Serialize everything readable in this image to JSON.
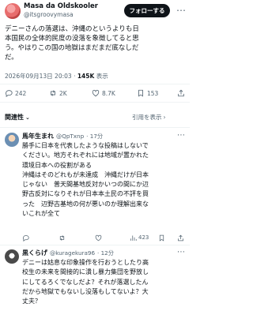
{
  "header": {
    "name": "Masa da Oldskooler",
    "handle": "@itsgroovymasa",
    "follow_label": "フォローする",
    "more": "⋯"
  },
  "post": {
    "lines": [
      "デニーさんの落選は、沖縄のというよりも日",
      "本国民の全体的民度の没落を象徴してると思",
      "う。やはりこの国の地獄はまだまだ底なしだ",
      "だ。"
    ],
    "datetime": "2026年09月13日 20:03",
    "views_count": "145K",
    "views_label": "表示"
  },
  "stats": {
    "replies": "242",
    "reposts": "2K",
    "likes": "8.7K",
    "bookmarks": "153"
  },
  "filter": {
    "relevance_label": "関連性",
    "quotes_label": "引用を表示"
  },
  "replies": [
    {
      "name": "馬年生まれ",
      "handle": "@QpTxnp",
      "time": "· 17分",
      "lines": [
        "勝手に日本を代表したような投稿はしないで",
        "ください。地方それぞれには地域が置かれた",
        "環境日本への役割がある",
        "沖縄はそのどれもが未達成　沖縄だけが日本",
        "じゃない　普天間基地反対かいつの間にか辺",
        "野古反対になりそれが日本本土民の不評を買",
        "った　辺野古基地の何が悪いのか理解出来な",
        "いこれが全て"
      ],
      "views": "423"
    },
    {
      "name": "黒くらげ",
      "handle": "@kuragekura96",
      "time": "· 12分",
      "lines": [
        "デニーは姑息な印象操作を行おうとしたり高",
        "校生の未来を間接的に潰し暴力集団を野放し",
        "にしてるろくでなしだよ？それが落選したん",
        "だから地獄でもないし没落もしてないよ？大",
        "丈夫？"
      ]
    }
  ],
  "colors": {
    "text": "#0f1419",
    "muted": "#536471",
    "button_bg": "#0f1419",
    "divider": "#eff3f4"
  }
}
